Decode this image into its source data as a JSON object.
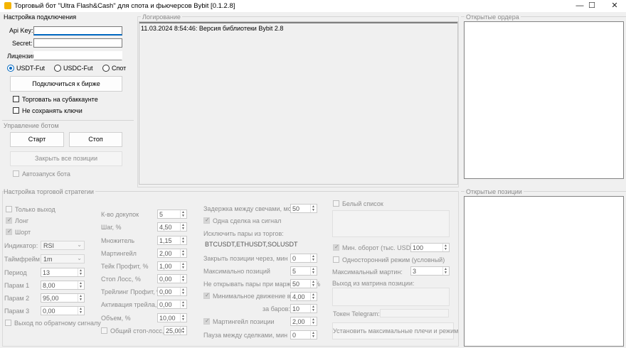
{
  "window": {
    "title": "Торговый бот \"Ultra Flash&Cash\" для спота и фьючерсов Bybit [0.1.2.8]",
    "minimize": "—",
    "maximize": "☐",
    "close": "✕"
  },
  "connection": {
    "title": "Настройка подключения",
    "api_key_label": "Api Key:",
    "api_key_value": "",
    "secret_label": "Secret:",
    "secret_value": "",
    "license_label": "Лицензия:",
    "license_value": "",
    "market_options": [
      {
        "label": "USDT-Fut",
        "selected": true
      },
      {
        "label": "USDC-Fut",
        "selected": false
      },
      {
        "label": "Спот",
        "selected": false
      }
    ],
    "connect_button": "Подключиться к бирже",
    "subaccount_label": "Торговать на субаккаунте",
    "no_save_keys_label": "Не сохранять ключи"
  },
  "bot_control": {
    "title": "Управление ботом",
    "start_button": "Старт",
    "stop_button": "Стоп",
    "close_all_button": "Закрыть все позиции",
    "autostart_label": "Автозапуск бота"
  },
  "logging": {
    "title": "Логирование",
    "lines": [
      "11.03.2024 8:54:46: Версия библиотеки Bybit 2.8"
    ]
  },
  "open_orders": {
    "title": "Открытые ордера"
  },
  "open_positions": {
    "title": "Открытые позиции"
  },
  "strategy": {
    "title": "Настройка торговой стратегии",
    "only_exit_label": "Только выход",
    "long_label": "Лонг",
    "short_label": "Шорт",
    "indicator_label": "Индикатор:",
    "indicator_value": "RSI",
    "timeframe_label": "Таймфрейм",
    "timeframe_value": "1m",
    "period_label": "Период",
    "period_value": "13",
    "param1_label": "Парам 1",
    "param1_value": "8,00",
    "param2_label": "Парам 2",
    "param2_value": "95,00",
    "param3_label": "Парам 3",
    "param3_value": "0,00",
    "reverse_exit_label": "Выход по обратному сигналу",
    "buy_count_label": "К-во докупок",
    "buy_count_value": "5",
    "step_label": "Шаг, %",
    "step_value": "4,50",
    "multiplier_label": "Множитель",
    "multiplier_value": "1,15",
    "martingale_label": "Мартингейл",
    "martingale_value": "2,00",
    "take_profit_label": "Тейк Профит, %",
    "take_profit_value": "1,00",
    "stop_loss_label": "Стоп Лосс, %",
    "stop_loss_value": "0,00",
    "trailing_profit_label": "Трейлинг Профит, %",
    "trailing_profit_value": "0,00",
    "trailing_activation_label": "Активация трейла, %",
    "trailing_activation_value": "0,00",
    "volume_label": "Объем, %",
    "volume_value": "10,00",
    "common_stop_label": "Общий стоп-лосс, %",
    "common_stop_value": "25,00",
    "candle_delay_label": "Задержка между свечами, мс",
    "candle_delay_value": "50",
    "one_trade_label": "Одна сделка на сигнал",
    "exclude_pairs_label": "Исключить пары из торгов:",
    "exclude_pairs_value": "BTCUSDT,ETHUSDT,SOLUSDT",
    "close_after_label": "Закрыть позиции через, мин",
    "close_after_value": "0",
    "max_positions_label": "Максимально позиций",
    "max_positions_value": "5",
    "no_open_margin_label": "Не открывать пары при марже ниже, %",
    "no_open_margin_value": "50",
    "min_move_label": "Минимальное движение в %",
    "min_move_value": "4,00",
    "bars_label": "за баров:",
    "bars_value": "10",
    "martingale_pos_label": "Мартингейл позиции",
    "martingale_pos_value": "2,00",
    "pause_label": "Пауза между сделками, мин",
    "pause_value": "0",
    "whitelist_label": "Белый список",
    "min_turnover_label": "Мин. оборот (тыс. USDT)",
    "min_turnover_value": "100",
    "one_way_label": "Односторонний режим (условный)",
    "max_martin_label": "Максимальный мартин:",
    "max_martin_value": "3",
    "martin_exit_label": "Выход из матрина позиции:",
    "telegram_label": "Токен Telegram:",
    "set_leverage_button": "Установить максимальные плечи и режим"
  }
}
